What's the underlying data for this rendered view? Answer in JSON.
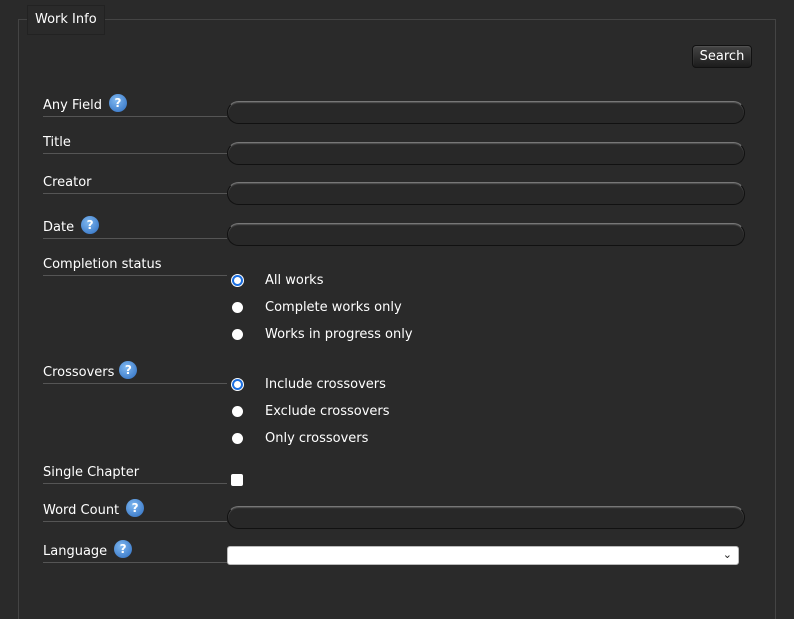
{
  "legend": "Work Info",
  "search_label": "Search",
  "fields": {
    "any_field": "Any Field",
    "title": "Title",
    "creator": "Creator",
    "date": "Date",
    "completion_status": "Completion status",
    "crossovers": "Crossovers",
    "single_chapter": "Single Chapter",
    "word_count": "Word Count",
    "language": "Language"
  },
  "help_glyph": "?",
  "completion_options": [
    "All works",
    "Complete works only",
    "Works in progress only"
  ],
  "completion_selected": "All works",
  "crossover_options": [
    "Include crossovers",
    "Exclude crossovers",
    "Only crossovers"
  ],
  "crossover_selected": "Include crossovers",
  "single_chapter_checked": false,
  "language_selected": "",
  "colors": {
    "background": "#2a2a2a",
    "accent": "#1a6ee0",
    "help": "#2c6cc0"
  }
}
